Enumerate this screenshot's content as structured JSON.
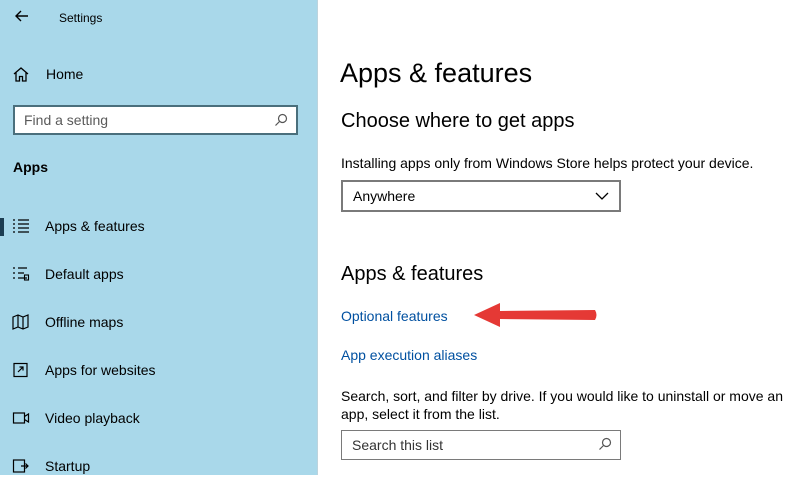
{
  "window": {
    "title": "Settings",
    "back_icon": "back-arrow-icon"
  },
  "sidebar": {
    "home_label": "Home",
    "search_placeholder": "Find a setting",
    "section_label": "Apps",
    "items": [
      {
        "label": "Apps & features",
        "icon": "apps-features-icon",
        "selected": true
      },
      {
        "label": "Default apps",
        "icon": "default-apps-icon",
        "selected": false
      },
      {
        "label": "Offline maps",
        "icon": "offline-maps-icon",
        "selected": false
      },
      {
        "label": "Apps for websites",
        "icon": "apps-for-websites-icon",
        "selected": false
      },
      {
        "label": "Video playback",
        "icon": "video-playback-icon",
        "selected": false
      },
      {
        "label": "Startup",
        "icon": "startup-icon",
        "selected": false
      }
    ]
  },
  "main": {
    "page_title": "Apps & features",
    "choose_heading": "Choose where to get apps",
    "choose_description": "Installing apps only from Windows Store helps protect your device.",
    "source_dropdown": {
      "selected": "Anywhere"
    },
    "section_heading": "Apps & features",
    "links": {
      "optional_features": "Optional features",
      "execution_aliases": "App execution aliases"
    },
    "filter_description_line1": "Search, sort, and filter by drive. If you would like to uninstall or move an",
    "filter_description_line2": "app, select it from the list.",
    "list_search_placeholder": "Search this list"
  },
  "colors": {
    "sidebar_bg": "#a9d8ea",
    "link": "#0050a0",
    "annotation_arrow": "#e53935"
  }
}
